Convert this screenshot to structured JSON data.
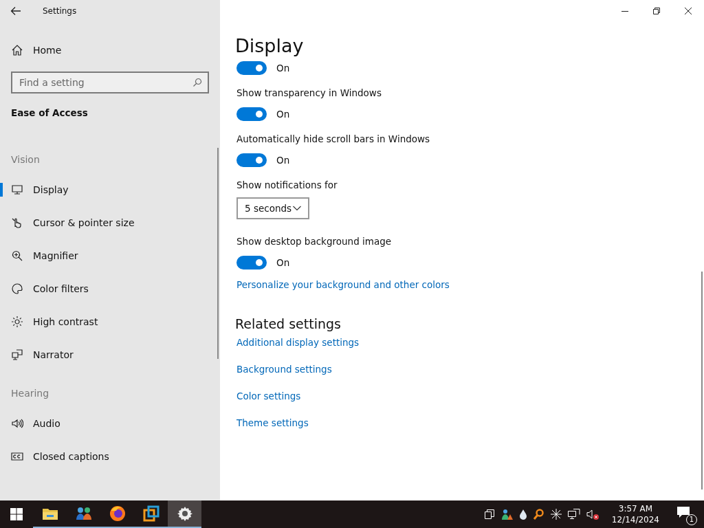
{
  "window": {
    "title": "Settings"
  },
  "sidebar": {
    "home": "Home",
    "search": {
      "placeholder": "Find a setting"
    },
    "category": "Ease of Access",
    "groups": [
      {
        "heading": "Vision",
        "items": [
          {
            "label": "Display",
            "selected": true
          },
          {
            "label": "Cursor & pointer size",
            "selected": false
          },
          {
            "label": "Magnifier",
            "selected": false
          },
          {
            "label": "Color filters",
            "selected": false
          },
          {
            "label": "High contrast",
            "selected": false
          },
          {
            "label": "Narrator",
            "selected": false
          }
        ]
      },
      {
        "heading": "Hearing",
        "items": [
          {
            "label": "Audio",
            "selected": false
          },
          {
            "label": "Closed captions",
            "selected": false
          }
        ]
      }
    ]
  },
  "main": {
    "title": "Display",
    "settings": [
      {
        "kind": "toggle",
        "on": true,
        "state": "On"
      },
      {
        "kind": "toggle",
        "label": "Show transparency in Windows",
        "on": true,
        "state": "On"
      },
      {
        "kind": "toggle",
        "label": "Automatically hide scroll bars in Windows",
        "on": true,
        "state": "On"
      },
      {
        "kind": "dropdown",
        "label": "Show notifications for",
        "value": "5 seconds"
      },
      {
        "kind": "toggle",
        "label": "Show desktop background image",
        "on": true,
        "state": "On"
      },
      {
        "kind": "link",
        "label": "Personalize your background and other colors"
      }
    ],
    "related": {
      "heading": "Related settings",
      "links": [
        "Additional display settings",
        "Background settings",
        "Color settings",
        "Theme settings"
      ]
    }
  },
  "taskbar": {
    "apps": [
      {
        "active": false
      },
      {
        "active": false
      },
      {
        "active": false
      },
      {
        "active": false
      },
      {
        "active": true
      }
    ],
    "clock": {
      "time": "3:57 AM",
      "date": "12/14/2024"
    },
    "notifications": "1"
  }
}
